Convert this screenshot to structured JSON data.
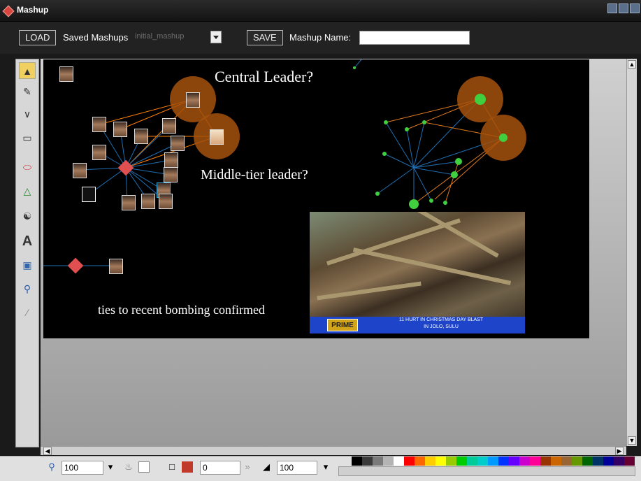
{
  "window": {
    "title": "Mashup"
  },
  "toolbar": {
    "load_label": "LOAD",
    "saved_label": "Saved Mashups",
    "saved_value": "initial_mashup",
    "save_label": "SAVE",
    "name_label": "Mashup Name:",
    "name_value": ""
  },
  "tools": [
    "select-icon",
    "pen-icon",
    "vector-pen-icon",
    "rectangle-icon",
    "ellipse-icon",
    "triangle-icon",
    "database-icon",
    "text-icon",
    "image-icon",
    "zoom-icon",
    "eyedropper-icon"
  ],
  "canvas": {
    "annotations": [
      "Central Leader?",
      "Middle-tier leader?",
      "ties to recent bombing confirmed"
    ]
  },
  "video": {
    "brand": "PRIME",
    "ticker_line1": "11 HURT IN CHRISTMAS DAY BLAST",
    "ticker_line2": "IN JOLO, SULU"
  },
  "bottom": {
    "zoom": "100",
    "stroke_width": "0",
    "opacity": "100"
  },
  "palette": [
    "#000000",
    "#3a3a3a",
    "#7a7a7a",
    "#b4b4b4",
    "#ffffff",
    "#ff0000",
    "#ff6600",
    "#ffcc00",
    "#ffff00",
    "#99cc00",
    "#00cc00",
    "#00cc99",
    "#00cccc",
    "#0099ff",
    "#0033ff",
    "#6600ff",
    "#cc00cc",
    "#ff0099",
    "#993300",
    "#cc6600",
    "#996633",
    "#669900",
    "#006600",
    "#003366",
    "#000099",
    "#330066",
    "#660033"
  ]
}
